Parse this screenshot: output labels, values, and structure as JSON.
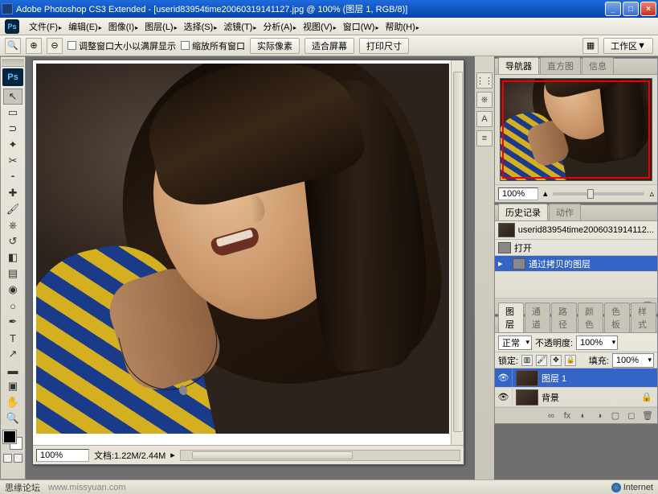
{
  "title": {
    "app": "Adobe Photoshop CS3 Extended",
    "doc": "[userid83954time20060319141127.jpg @ 100% (图层 1, RGB/8)]"
  },
  "menu": [
    "文件(F)",
    "编辑(E)",
    "图像(I)",
    "图层(L)",
    "选择(S)",
    "滤镜(T)",
    "分析(A)",
    "视图(V)",
    "窗口(W)",
    "帮助(H)"
  ],
  "options": {
    "chk1": "调整窗口大小以满屏显示",
    "chk2": "缩放所有窗口",
    "btn1": "实际像素",
    "btn2": "适合屏幕",
    "btn3": "打印尺寸",
    "workspace": "工作区"
  },
  "doc_status": {
    "zoom": "100%",
    "info": "文档:1.22M/2.44M"
  },
  "panels": {
    "navigator": {
      "tab1": "导航器",
      "tab2": "直方图",
      "tab3": "信息",
      "zoom": "100%"
    },
    "history": {
      "tab1": "历史记录",
      "tab2": "动作",
      "snapshot": "userid83954time2006031914112...",
      "items": [
        "打开",
        "通过拷贝的图层"
      ]
    },
    "layers": {
      "tabs": [
        "图层",
        "通道",
        "路径",
        "颜色",
        "色板",
        "样式"
      ],
      "blend": "正常",
      "opacity_lbl": "不透明度:",
      "opacity": "100%",
      "lock_lbl": "锁定:",
      "fill_lbl": "填充:",
      "fill": "100%",
      "items": [
        "图层 1",
        "背景"
      ]
    }
  },
  "status": {
    "left": "思缘论坛",
    "url": "www.missyuan.com",
    "net": "Internet"
  }
}
